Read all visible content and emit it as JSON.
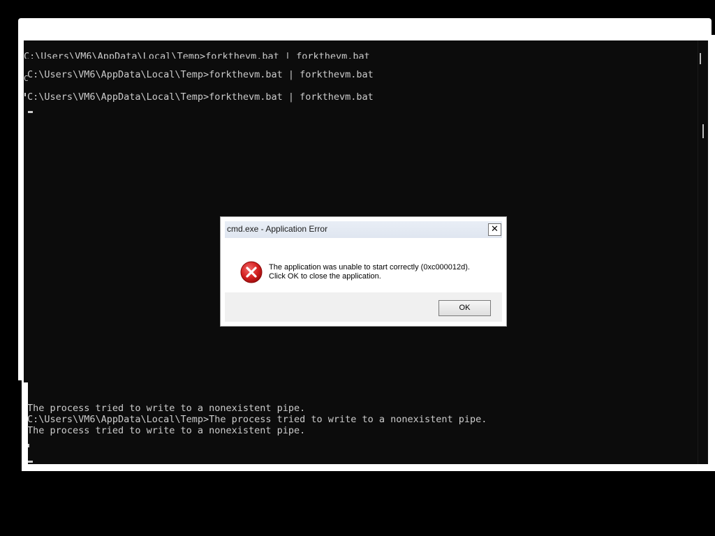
{
  "console": {
    "lines_top": [
      "C:\\Users\\VM6\\AppData\\Local\\Temp>forkthevm.bat | forkthevm.bat",
      "C:\\Users\\VM6\\AppData\\Local\\Temp>forkthevm.bat | forkthevm.bat",
      "C:\\Users\\VM6\\AppData\\Local\\Temp>forkthevm.bat | forkthevm.bat"
    ],
    "lines_bottom": [
      "The process tried to write to a nonexistent pipe.",
      "C:\\Users\\VM6\\AppData\\Local\\Temp>The process tried to write to a nonexistent pipe.",
      "The process tried to write to a nonexistent pipe."
    ],
    "stray_char": "C"
  },
  "dialog": {
    "title": "cmd.exe - Application Error",
    "close_label": "✕",
    "message_line1": "The application was unable to start correctly (0xc000012d).",
    "message_line2": "Click OK to close the application.",
    "ok_label": "OK",
    "icon": "error-icon"
  },
  "colors": {
    "console_bg": "#0c0c0c",
    "console_text": "#cccccc",
    "error_red": "#d42020"
  }
}
